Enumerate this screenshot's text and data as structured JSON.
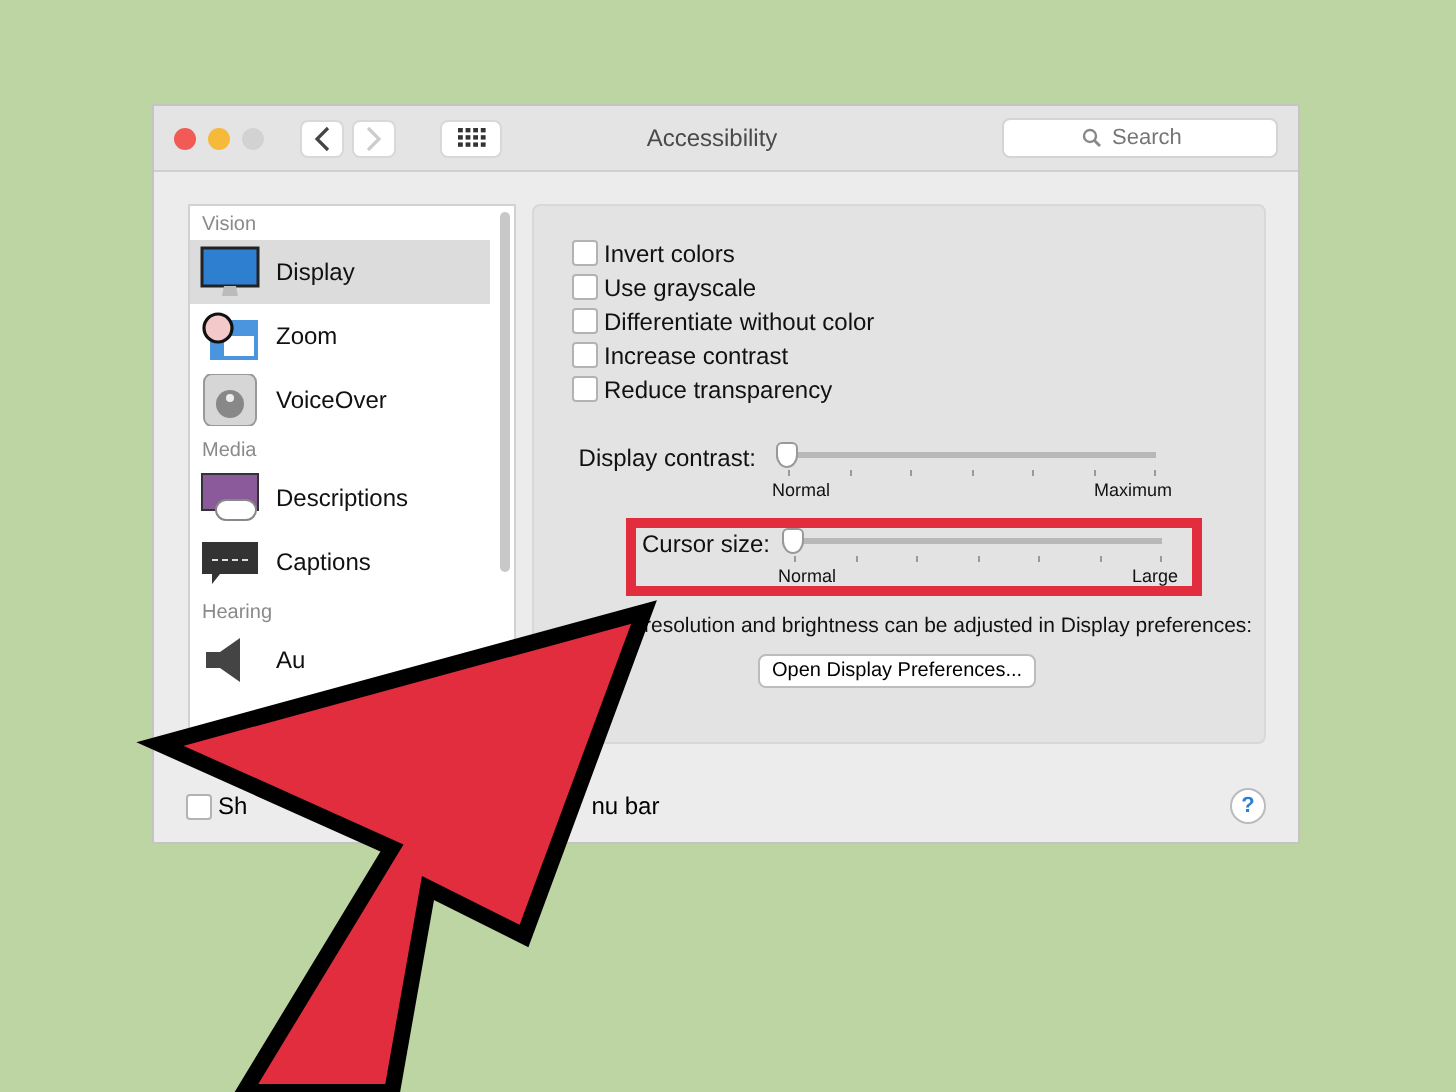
{
  "window": {
    "title": "Accessibility",
    "search": {
      "placeholder": "Search"
    }
  },
  "sidebar": [
    {
      "heading": "Vision",
      "items": [
        {
          "label": "Display",
          "selected": true,
          "kind": "display"
        },
        {
          "label": "Zoom",
          "selected": false,
          "kind": "zoom"
        },
        {
          "label": "VoiceOver",
          "selected": false,
          "kind": "voiceover"
        }
      ]
    },
    {
      "heading": "Media",
      "items": [
        {
          "label": "Descriptions",
          "selected": false,
          "kind": "descriptions"
        },
        {
          "label": "Captions",
          "selected": false,
          "kind": "captions"
        }
      ]
    },
    {
      "heading": "Hearing",
      "items": [
        {
          "label": "Au",
          "selected": false,
          "kind": "audio"
        }
      ]
    }
  ],
  "options": [
    {
      "label": "Invert colors",
      "checked": false
    },
    {
      "label": "Use grayscale",
      "checked": false
    },
    {
      "label": "Differentiate without color",
      "checked": false
    },
    {
      "label": "Increase contrast",
      "checked": false
    },
    {
      "label": "Reduce transparency",
      "checked": false
    }
  ],
  "sliders": [
    {
      "label": "Display contrast:",
      "level": 0,
      "min_label": "Normal",
      "max_label": "Maximum",
      "highlighted": false
    },
    {
      "label": "Cursor size:",
      "level": 0,
      "min_label": "Normal",
      "max_label": "Large",
      "highlighted": true
    }
  ],
  "note": "resolution and brightness can be adjusted in Display preferences:",
  "button": "Open Display Preferences...",
  "bottom_checkbox": {
    "checked": false,
    "label_start": "Sh",
    "label_end": "nu bar"
  },
  "help": "?"
}
